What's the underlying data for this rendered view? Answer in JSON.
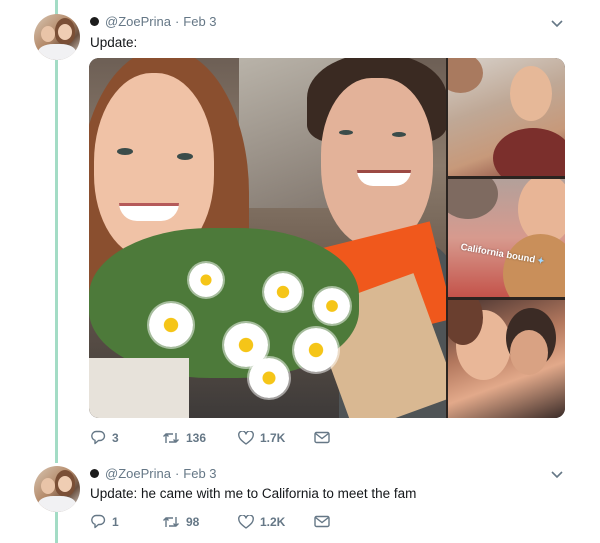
{
  "tweets": [
    {
      "author": {
        "handle": "@ZoePrina",
        "date": "Feb 3",
        "separator": "·"
      },
      "text": "Update:",
      "media": {
        "photo_overlay_text": "California bound"
      },
      "actions": {
        "replies": "3",
        "retweets": "136",
        "likes": "1.7K"
      }
    },
    {
      "author": {
        "handle": "@ZoePrina",
        "date": "Feb 3",
        "separator": "·"
      },
      "text": "Update: he came with me to California to meet the fam",
      "actions": {
        "replies": "1",
        "retweets": "98",
        "likes": "1.2K"
      }
    }
  ],
  "icons": {
    "badge": "dot-icon",
    "menu": "chevron-down-icon",
    "reply": "reply-icon",
    "retweet": "retweet-icon",
    "like": "heart-icon",
    "message": "envelope-icon",
    "pin": "pin-icon"
  },
  "colors": {
    "thread_line": "#a3dcc5",
    "secondary_text": "#657786",
    "primary_text": "#14171a"
  }
}
